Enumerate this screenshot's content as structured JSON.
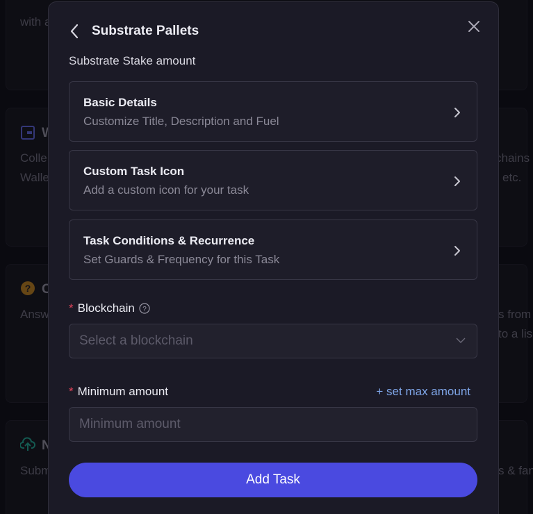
{
  "background": {
    "card1_text": "with a",
    "card2_title": "W",
    "card2_line1": "Colle",
    "card2_line2": "Walle",
    "card2_right1": "chains",
    "card2_right2": "etc.",
    "card3_title": "C",
    "card3_line1": "Answ",
    "card3_right1": "s from",
    "card3_right2": "to a lis",
    "card4_title": "N",
    "card4_line1": "Subm",
    "card4_right1": "s & fan"
  },
  "modal": {
    "title": "Substrate Pallets",
    "subtitle": "Substrate Stake amount",
    "sections": [
      {
        "title": "Basic Details",
        "desc": "Customize Title, Description and Fuel"
      },
      {
        "title": "Custom Task Icon",
        "desc": "Add a custom icon for your task"
      },
      {
        "title": "Task Conditions & Recurrence",
        "desc": "Set Guards & Frequency for this Task"
      }
    ],
    "blockchain": {
      "required_mark": "*",
      "label": "Blockchain",
      "placeholder": "Select a blockchain"
    },
    "minimum": {
      "required_mark": "*",
      "label": "Minimum amount",
      "max_link": "+ set max amount",
      "placeholder": "Minimum amount"
    },
    "add_button": "Add Task"
  },
  "colors": {
    "accent": "#4a4ae0",
    "link": "#7fa6e8",
    "required": "#e0445a"
  },
  "icons": [
    "back-icon",
    "close-icon",
    "chevron-right-icon",
    "help-icon",
    "chevron-down-icon",
    "wallet-icon",
    "question-icon",
    "upload-icon"
  ]
}
